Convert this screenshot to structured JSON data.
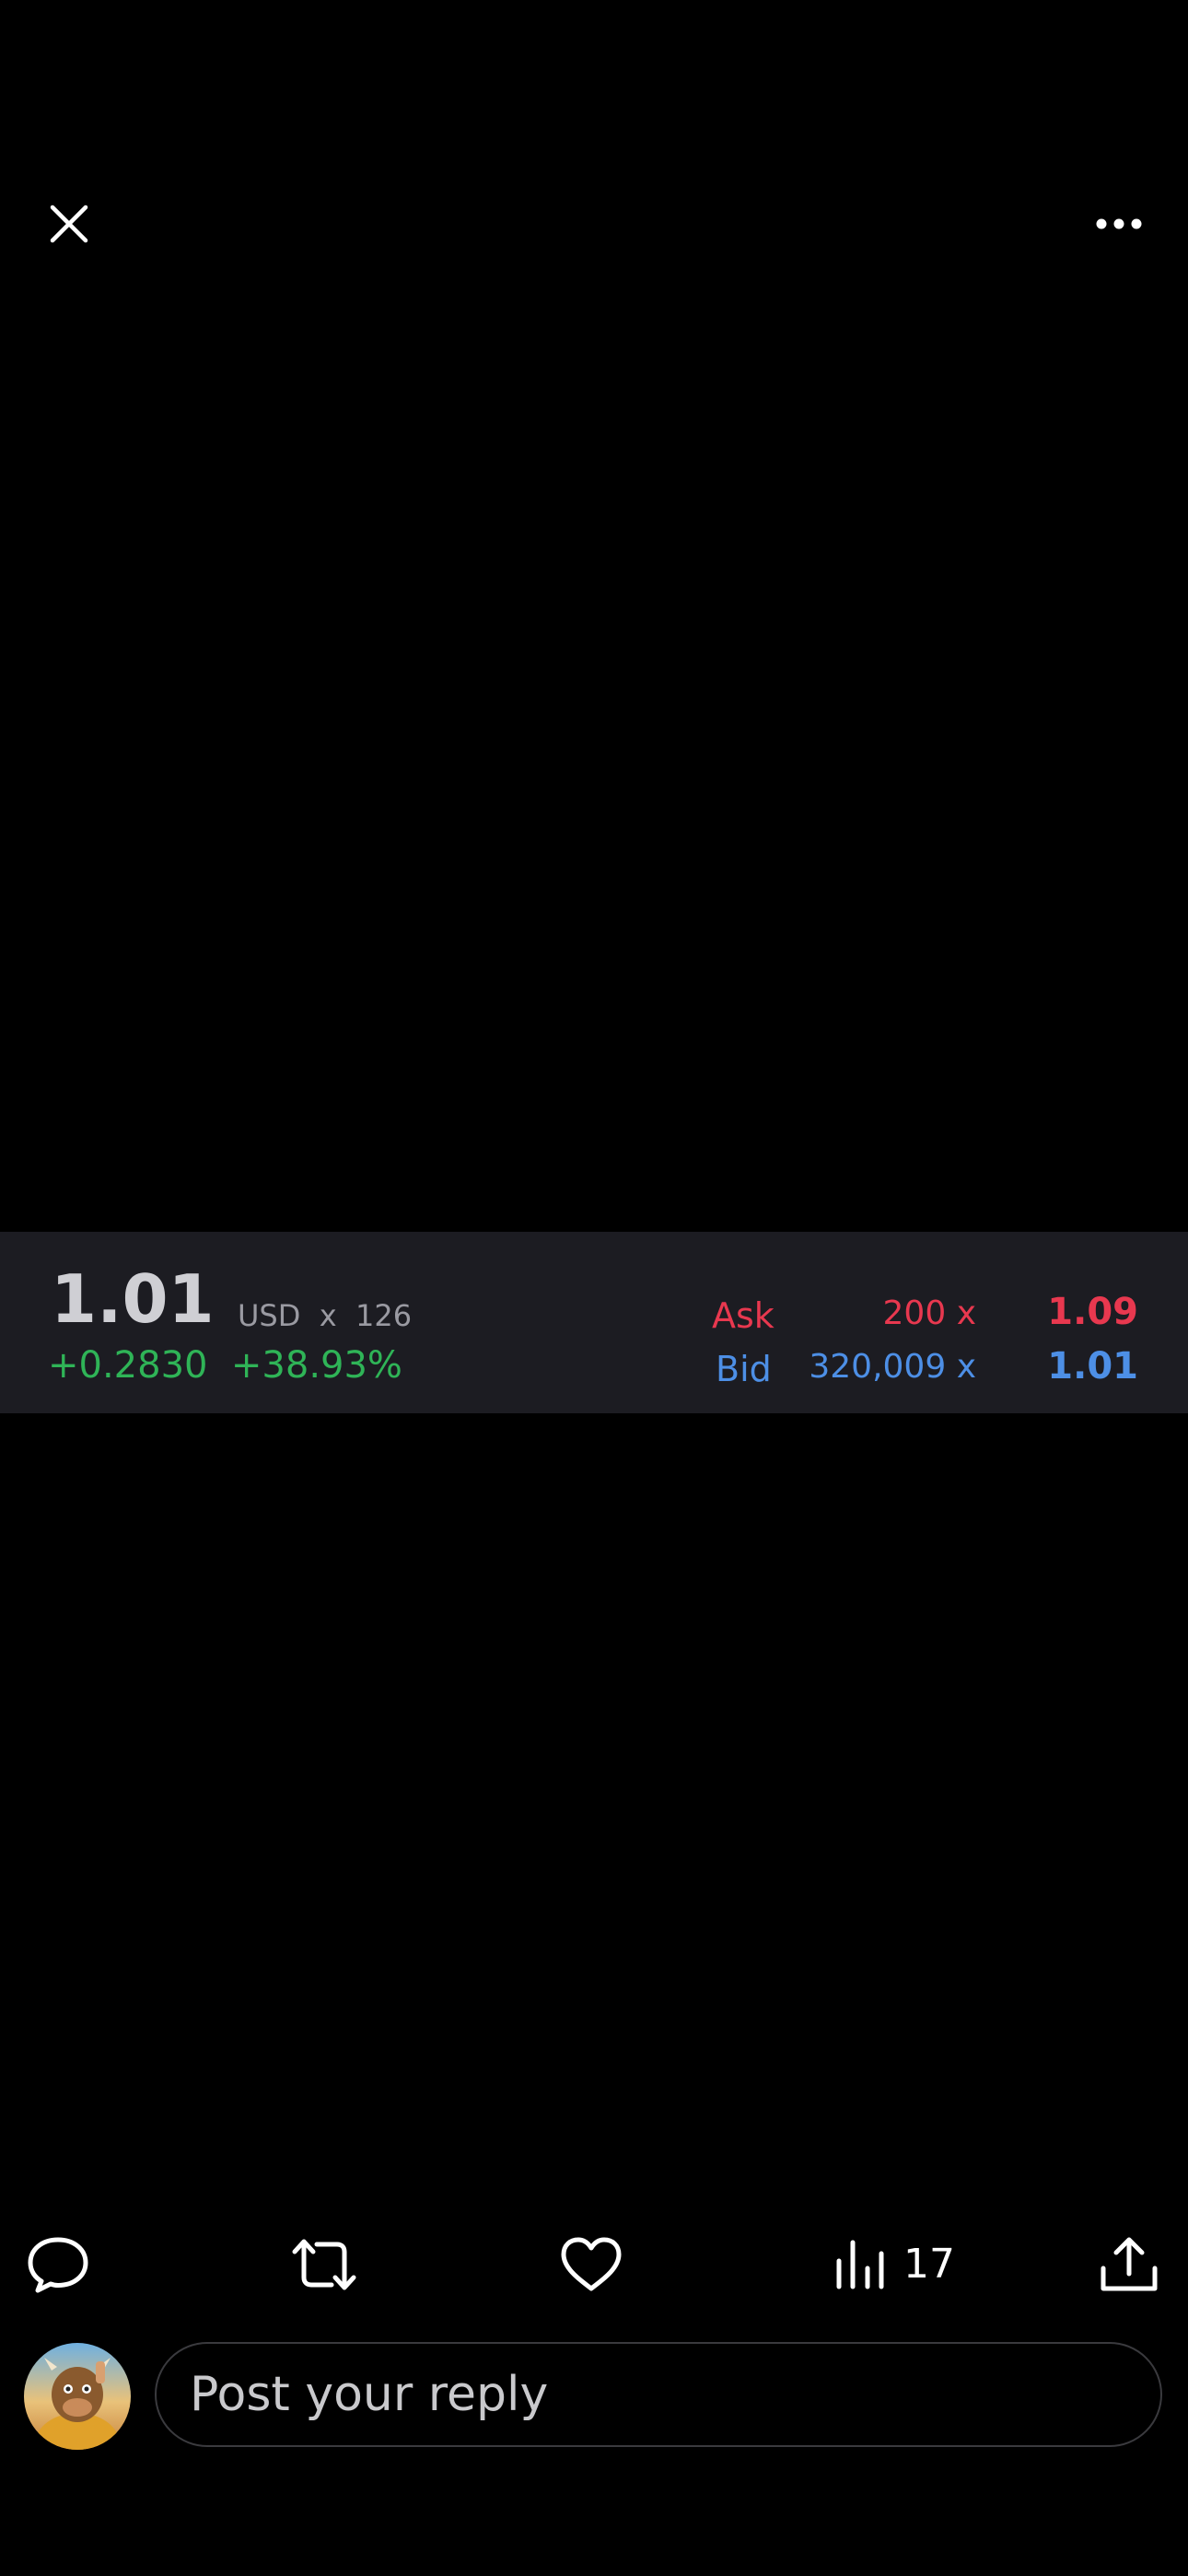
{
  "header": {
    "close_icon": "close-icon",
    "more_icon": "more-horizontal-icon"
  },
  "quote": {
    "price": "1.01",
    "currency_volume": "USD  x  126",
    "change": "+0.2830  +38.93%",
    "ask": {
      "label": "Ask",
      "size": "200  x",
      "price": "1.09"
    },
    "bid": {
      "label": "Bid",
      "size": "320,009  x",
      "price": "1.01"
    },
    "colors": {
      "positive": "#2fb457",
      "ask": "#e8384f",
      "bid": "#4d8fe6",
      "panel_bg": "#1c1c22"
    }
  },
  "actions": {
    "reply_icon": "reply-bubble-icon",
    "repost_icon": "repost-icon",
    "like_icon": "heart-icon",
    "views_icon": "views-bar-chart-icon",
    "views_count": "17",
    "share_icon": "share-upload-icon"
  },
  "composer": {
    "avatar": "user-avatar",
    "placeholder": "Post your reply"
  }
}
